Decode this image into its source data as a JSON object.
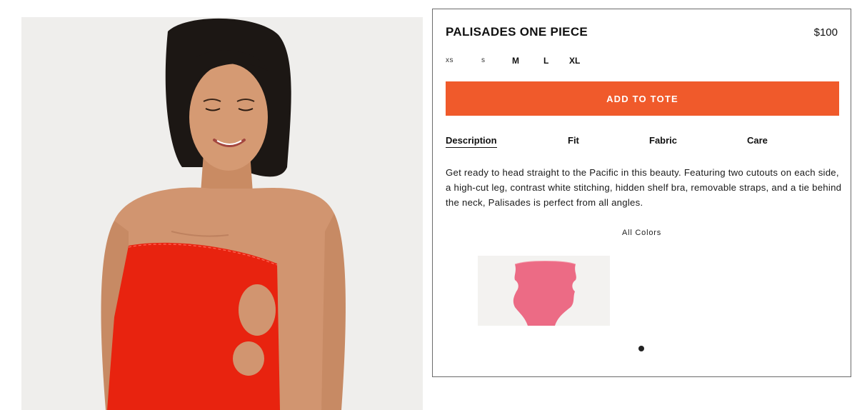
{
  "product": {
    "title": "PALISADES ONE PIECE",
    "price": "$100",
    "image_alt": "Model wearing red strapless one piece swimsuit with side cutouts"
  },
  "sizes": [
    {
      "label": "XS",
      "available": false
    },
    {
      "label": "S",
      "available": false
    },
    {
      "label": "M",
      "available": true
    },
    {
      "label": "L",
      "available": true
    },
    {
      "label": "XL",
      "available": true
    }
  ],
  "add_to_tote_label": "ADD TO TOTE",
  "tabs": [
    {
      "label": "Description",
      "active": true
    },
    {
      "label": "Fit",
      "active": false
    },
    {
      "label": "Fabric",
      "active": false
    },
    {
      "label": "Care",
      "active": false
    }
  ],
  "description": "Get ready to head straight to the Pacific in this beauty. Featuring two cutouts on each side, a high-cut leg, contrast white stitching, hidden shelf bra, removable straps, and a tie behind the neck, Palisades is perfect from all angles.",
  "colors": {
    "heading": "All Colors",
    "swatches": [
      {
        "name": "pink",
        "color": "#ec6b85"
      }
    ]
  },
  "carousel": {
    "pages": 1,
    "current": 1
  },
  "theme": {
    "accent": "#f05a2b",
    "swimsuit_red": "#e8230f"
  }
}
